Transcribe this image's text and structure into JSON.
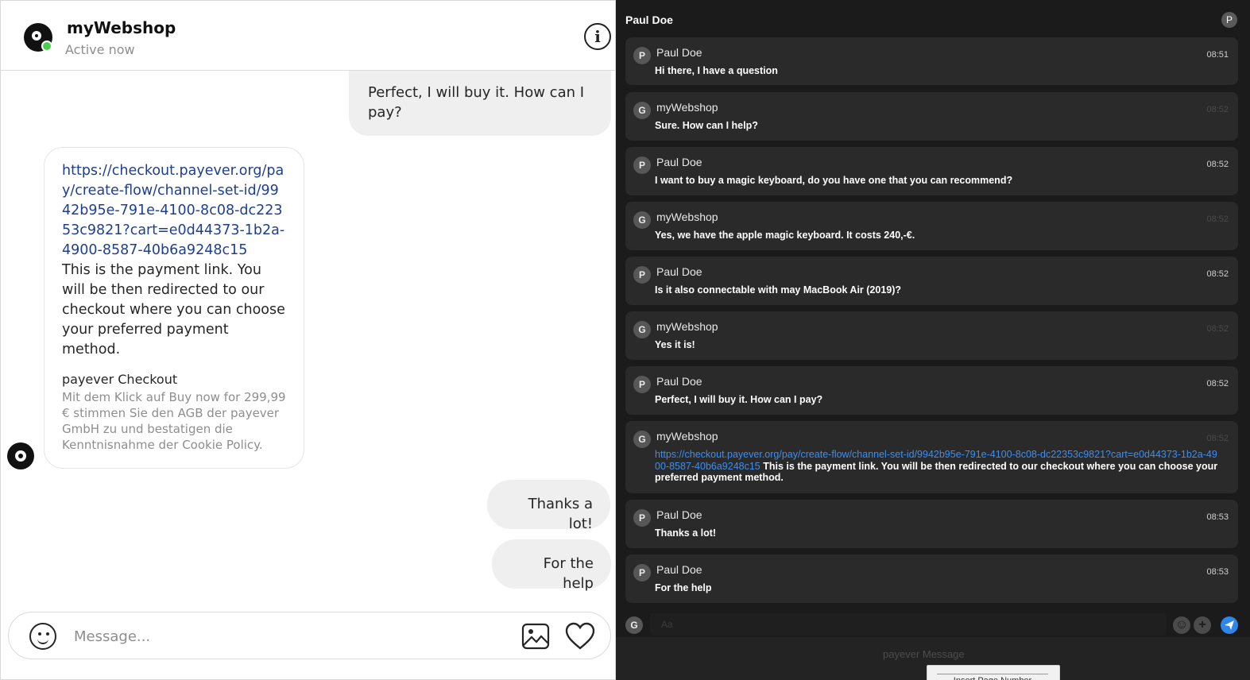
{
  "left": {
    "header": {
      "shop_name": "myWebshop",
      "status": "Active now"
    },
    "messages": {
      "out_1": "Perfect, I will buy it. How can I pay?",
      "in_link": "https://checkout.payever.org/pay/create-flow/channel-set-id/9942b95e-791e-4100-8c08-dc22353c9821?cart=e0d44373-1b2a-4900-8587-40b6a9248c15",
      "in_text": "This is the payment link. You will be then redirected to our checkout where you can choose your preferred payment method.",
      "card_title": "payever Checkout",
      "card_text": "Mit dem Klick auf Buy now for 299,99 € stimmen Sie den AGB der payever GmbH zu und bestatigen die Kenntnisnahme der Cookie Policy.",
      "out_2": "Thanks a lot!",
      "out_3": "For the help"
    },
    "composer": {
      "placeholder": "Message..."
    }
  },
  "right": {
    "contact_name": "Paul Doe",
    "contact_initial": "P",
    "messages": [
      {
        "initial": "P",
        "sender": "Paul Doe",
        "time": "08:51",
        "text": "Hi there, I have a question"
      },
      {
        "initial": "G",
        "sender": "myWebshop",
        "time": "08:52",
        "text": "Sure. How can I help?"
      },
      {
        "initial": "P",
        "sender": "Paul Doe",
        "time": "08:52",
        "text": "I want to buy a magic keyboard, do you have one that you can recommend?"
      },
      {
        "initial": "G",
        "sender": "myWebshop",
        "time": "08:52",
        "text": "Yes, we have the apple magic keyboard. It costs 240,-€."
      },
      {
        "initial": "P",
        "sender": "Paul Doe",
        "time": "08:52",
        "text": "Is it also connectable with may MacBook Air (2019)?"
      },
      {
        "initial": "G",
        "sender": "myWebshop",
        "time": "08:52",
        "text": "Yes it is!"
      },
      {
        "initial": "P",
        "sender": "Paul Doe",
        "time": "08:52",
        "text": "Perfect, I will buy it. How can I pay?"
      },
      {
        "initial": "G",
        "sender": "myWebshop",
        "time": "08:52",
        "link": "https://checkout.payever.org/pay/create-flow/channel-set-id/9942b95e-791e-4100-8c08-dc22353c9821?cart=e0d44373-1b2a-4900-8587-40b6a9248c15",
        "text": "This is the payment link. You will be then redirected to our checkout where you can choose your preferred payment method."
      },
      {
        "initial": "P",
        "sender": "Paul Doe",
        "time": "08:53",
        "text": "Thanks a lot!"
      },
      {
        "initial": "P",
        "sender": "Paul Doe",
        "time": "08:53",
        "text": "For the help"
      }
    ],
    "composer": {
      "initial": "G",
      "placeholder": "Aa"
    },
    "footer": {
      "brand": "payever Message",
      "insert_page_number": "Insert Page Number"
    }
  }
}
